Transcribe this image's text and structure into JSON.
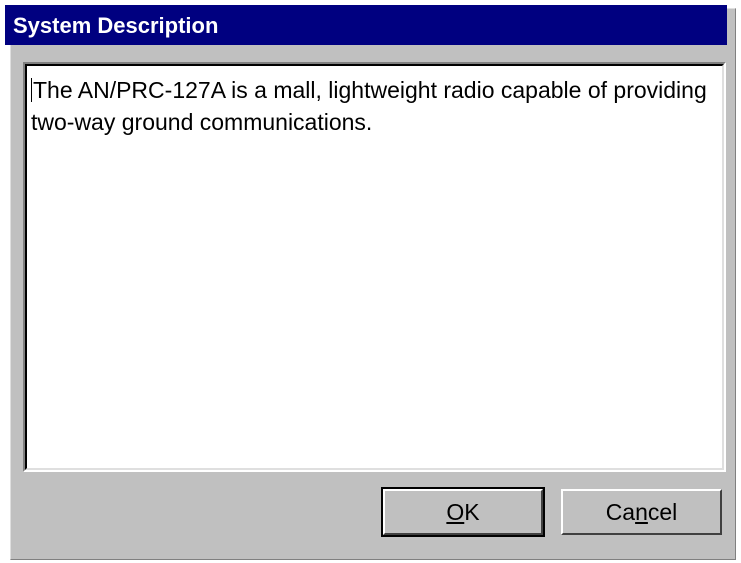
{
  "dialog": {
    "title": "System Description"
  },
  "description_field": {
    "value": "The AN/PRC-127A is a mall, lightweight radio capable of providing two-way ground communications."
  },
  "buttons": {
    "ok": {
      "prefix": "",
      "mnemonic": "O",
      "suffix": "K"
    },
    "cancel": {
      "prefix": "Ca",
      "mnemonic": "n",
      "suffix": "cel"
    }
  },
  "colors": {
    "titlebar": "#000080",
    "dialog_face": "#c0c0c0",
    "field_bg": "#ffffff"
  }
}
